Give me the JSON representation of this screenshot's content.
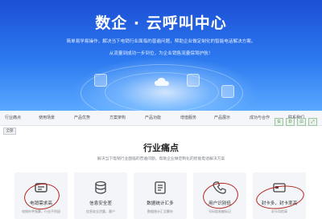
{
  "hero": {
    "title": "数企 · 云呼叫中心",
    "subtitle_line1": "简单易学易操作，解决当下电销行业面临的普遍问题，帮助企业做定制化的智能电话解决方案。",
    "subtitle_line2": "从流量到成功一步到位，为企业销售流量保驾护航！"
  },
  "nav": {
    "items": [
      "行业痛点",
      "使用场景",
      "产品优势",
      "方案架构",
      "产品功能",
      "增值服务",
      "产品展示",
      "成功与合作",
      "联系我们"
    ],
    "tools": [
      "G",
      "D",
      "⊡",
      "⤢"
    ],
    "tag": "全部"
  },
  "pain_points": {
    "title": "行业痛点",
    "subtitle": "解决当下电销行业面临的普遍问题，帮助企业做定制化的智能电话解决方案",
    "cards": [
      {
        "label": "电销需求高",
        "desc": "电销外呼频繁，行业不利因"
      },
      {
        "label": "信息安全差",
        "desc": "信息安全泄露，客户"
      },
      {
        "label": "数据统计汇多",
        "desc": "数据统计汇总繁杂"
      },
      {
        "label": "用户识别低",
        "desc": "号码容易被标记"
      },
      {
        "label": "封卡多，封卡率高",
        "desc": "封卡风险高"
      }
    ]
  },
  "colors": {
    "hero_top": "#1c4fd6",
    "hero_bottom": "#5aa8ff",
    "annotation": "#b3261e"
  }
}
